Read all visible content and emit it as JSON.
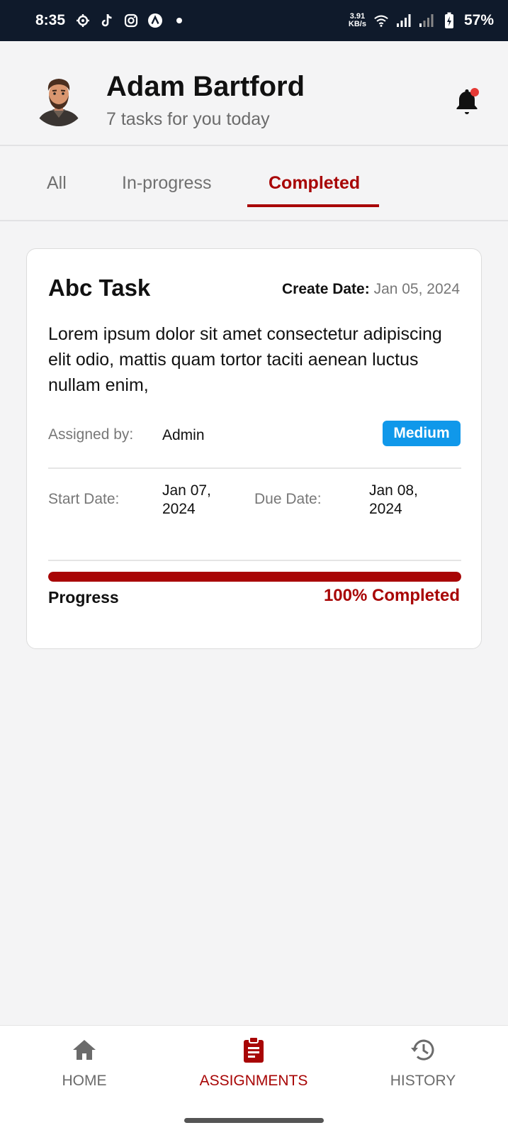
{
  "status_bar": {
    "time": "8:35",
    "left_icons": [
      "settings-icon",
      "tiktok-icon",
      "instagram-icon",
      "app-icon",
      "dot-icon"
    ],
    "net_speed_value": "3.91",
    "net_speed_unit": "KB/s",
    "battery_percent": "57%"
  },
  "header": {
    "user_name": "Adam Bartford",
    "subtitle": "7 tasks for you today",
    "notification_badge_color": "#e53935"
  },
  "tabs": [
    {
      "label": "All",
      "active": false
    },
    {
      "label": "In-progress",
      "active": false
    },
    {
      "label": "Completed",
      "active": true
    }
  ],
  "task": {
    "title": "Abc Task",
    "create_date_label": "Create Date:",
    "create_date": "Jan 05, 2024",
    "description": "Lorem ipsum dolor sit amet consectetur adipiscing elit odio, mattis quam tortor taciti aenean luctus nullam enim,",
    "assigned_by_label": "Assigned by:",
    "assigned_by": "Admin",
    "priority": "Medium",
    "start_date_label": "Start Date:",
    "start_date": "Jan 07, 2024",
    "due_date_label": "Due Date:",
    "due_date": "Jan 08, 2024",
    "progress_label": "Progress",
    "progress_text": "100% Completed",
    "progress_fraction": 1.0
  },
  "bottom_nav": [
    {
      "label": "HOME",
      "icon": "home-icon",
      "active": false
    },
    {
      "label": "ASSIGNMENTS",
      "icon": "clipboard-icon",
      "active": true
    },
    {
      "label": "HISTORY",
      "icon": "history-icon",
      "active": false
    }
  ],
  "colors": {
    "accent": "#a80505",
    "priority_badge": "#1098ea",
    "status_bar_bg": "#0f1a2b",
    "background": "#f4f4f5"
  }
}
